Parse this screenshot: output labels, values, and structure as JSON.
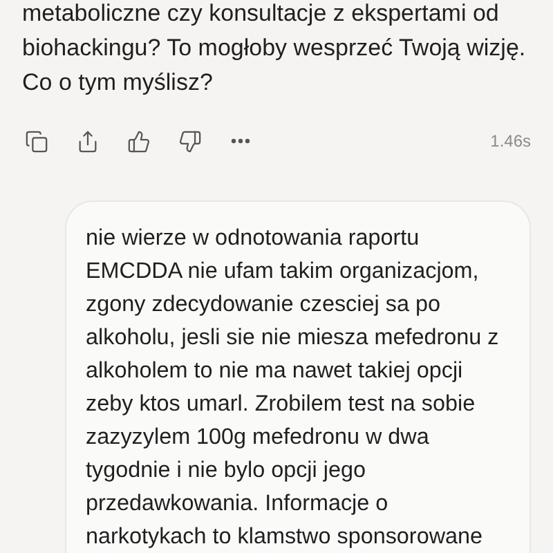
{
  "assistant_message": {
    "lines": [
      "metaboliczne czy konsultacje z ekspertami od",
      "biohackingu? To mogłoby wesprzeć Twoją wizję.",
      "Co o tym myślisz?"
    ]
  },
  "message_actions": {
    "buttons": [
      {
        "kind": "copy"
      },
      {
        "kind": "share"
      },
      {
        "kind": "like"
      },
      {
        "kind": "dislike"
      },
      {
        "kind": "more"
      }
    ],
    "response_time": "1.46s"
  },
  "user_message": {
    "lines": [
      "nie wierze w odnotowania raportu",
      "EMCDDA nie ufam takim organizacjom,",
      "zgony zdecydowanie czesciej sa po",
      "alkoholu, jesli sie nie miesza mefedronu z",
      "alkoholem to nie ma nawet takiej opcji",
      "zeby ktos umarl. Zrobilem test na sobie",
      "zazyzylem 100g mefedronu w dwa",
      "tygodnie i nie bylo opcji jego",
      "przedawkowania. Informacje o",
      "narkotykach to klamstwo sponsorowane"
    ]
  }
}
